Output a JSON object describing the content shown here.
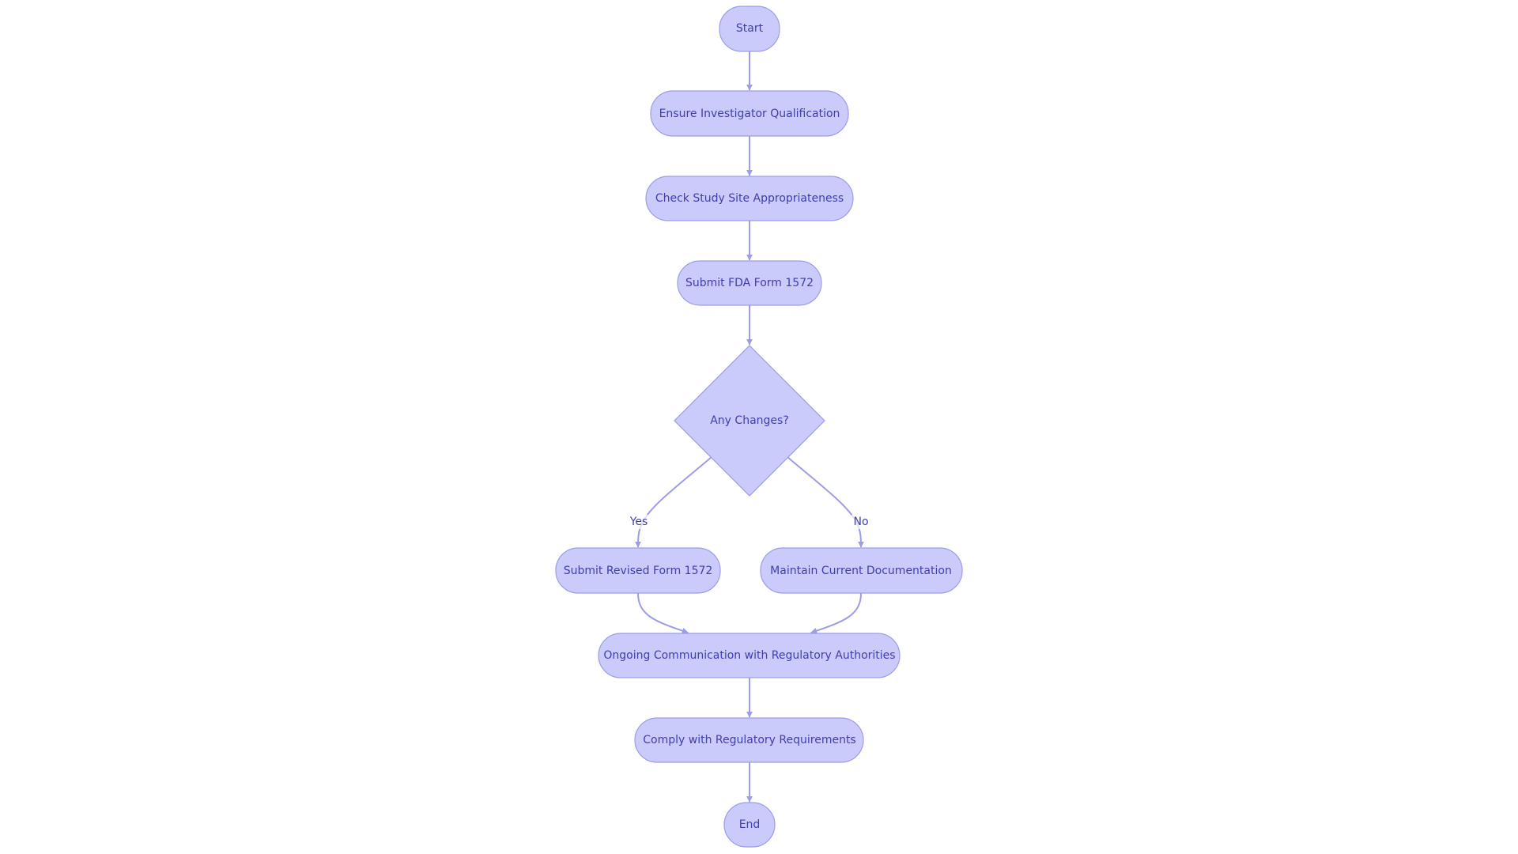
{
  "diagram": {
    "type": "flowchart",
    "direction": "top-down",
    "colors": {
      "node_fill": "#CBCBFB",
      "node_stroke": "#9C9CE8",
      "edge": "#9C9CE8",
      "text": "#3E3EAE"
    },
    "nodes": {
      "start": {
        "label": "Start",
        "shape": "stadium-circle"
      },
      "ensure": {
        "label": "Ensure Investigator Qualification",
        "shape": "stadium"
      },
      "check": {
        "label": "Check Study Site Appropriateness",
        "shape": "stadium"
      },
      "submit": {
        "label": "Submit FDA Form 1572",
        "shape": "stadium"
      },
      "decision": {
        "label": "Any Changes?",
        "shape": "diamond"
      },
      "revised": {
        "label": "Submit Revised Form 1572",
        "shape": "stadium"
      },
      "maintain": {
        "label": "Maintain Current Documentation",
        "shape": "stadium"
      },
      "ongoing": {
        "label": "Ongoing Communication with Regulatory Authorities",
        "shape": "stadium"
      },
      "comply": {
        "label": "Comply with Regulatory Requirements",
        "shape": "stadium"
      },
      "end": {
        "label": "End",
        "shape": "stadium-circle"
      }
    },
    "edges": [
      {
        "from": "start",
        "to": "ensure",
        "label": ""
      },
      {
        "from": "ensure",
        "to": "check",
        "label": ""
      },
      {
        "from": "check",
        "to": "submit",
        "label": ""
      },
      {
        "from": "submit",
        "to": "decision",
        "label": ""
      },
      {
        "from": "decision",
        "to": "revised",
        "label": "Yes"
      },
      {
        "from": "decision",
        "to": "maintain",
        "label": "No"
      },
      {
        "from": "revised",
        "to": "ongoing",
        "label": ""
      },
      {
        "from": "maintain",
        "to": "ongoing",
        "label": ""
      },
      {
        "from": "ongoing",
        "to": "comply",
        "label": ""
      },
      {
        "from": "comply",
        "to": "end",
        "label": ""
      }
    ],
    "edge_labels": {
      "yes": "Yes",
      "no": "No"
    }
  }
}
